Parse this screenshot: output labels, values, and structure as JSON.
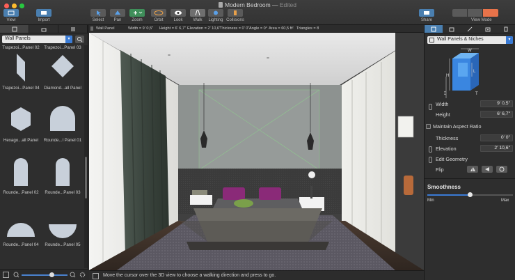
{
  "window": {
    "title": "Modern Bedroom",
    "status": "Edited"
  },
  "toolbar": {
    "view": "View",
    "import": "Import",
    "select": "Select",
    "pan": "Pan",
    "zoom": "Zoom",
    "orbit": "Orbit",
    "look": "Look",
    "walk": "Walk",
    "lighting": "Lighting",
    "collisions": "Collisions",
    "share": "Share",
    "view_mode": "View Mode"
  },
  "left_panel": {
    "category": "Wall Panels",
    "items": [
      {
        "label": "Trapezoi...Panel 02",
        "shape": "trapezoid-partial-icon"
      },
      {
        "label": "Trapezoi...Panel 03",
        "shape": "trapezoid-partial-icon"
      },
      {
        "label": "Trapezoi...Panel 04",
        "shape": "trapezoid-icon"
      },
      {
        "label": "Diamond...all Panel",
        "shape": "diamond-icon"
      },
      {
        "label": "Hexago...all Panel",
        "shape": "hexagon-icon"
      },
      {
        "label": "Rounde...l Panel 01",
        "shape": "arch-wide-icon"
      },
      {
        "label": "Rounde...Panel 02",
        "shape": "arch-tall-icon"
      },
      {
        "label": "Rounde...Panel 03",
        "shape": "arch-tall-icon"
      },
      {
        "label": "Rounde...Panel 04",
        "shape": "half-circle-icon"
      },
      {
        "label": "Rounde...Panel 05",
        "shape": "half-circle-icon"
      }
    ]
  },
  "info_bar": {
    "object": "Wall Panel",
    "width": "Width = 9' 0,5\"",
    "height": "Height = 6' 6,7\"",
    "elevation": "Elevation = 2' 10,6\"",
    "thickness": "Thickness = 0' 0\"",
    "angle": "Angle = 0°",
    "area": "Area = 60,5 ft²",
    "triangles": "Triangles = 8"
  },
  "status_bar": {
    "message": "Move the cursor over the 3D view to choose a walking direction and press to go."
  },
  "inspector": {
    "category": "Wall Panels & Niches",
    "diagram": {
      "w": "W",
      "h": "H",
      "e": "E",
      "l": "L",
      "t": "T"
    },
    "width_label": "Width",
    "width_value": "9' 0,5\"",
    "height_label": "Height",
    "height_value": "6' 6,7\"",
    "maintain_aspect": "Maintain Aspect Ratio",
    "thickness_label": "Thickness",
    "thickness_value": "0' 0\"",
    "elevation_label": "Elevation",
    "elevation_value": "2' 10,6\"",
    "edit_geometry": "Edit Geometry",
    "flip_label": "Flip",
    "smoothness_label": "Smoothness",
    "smoothness_min": "Min",
    "smoothness_max": "Max",
    "smoothness_level": 0.5
  },
  "colors": {
    "accent": "#3a7bd5",
    "active_view": "#e8734a"
  }
}
